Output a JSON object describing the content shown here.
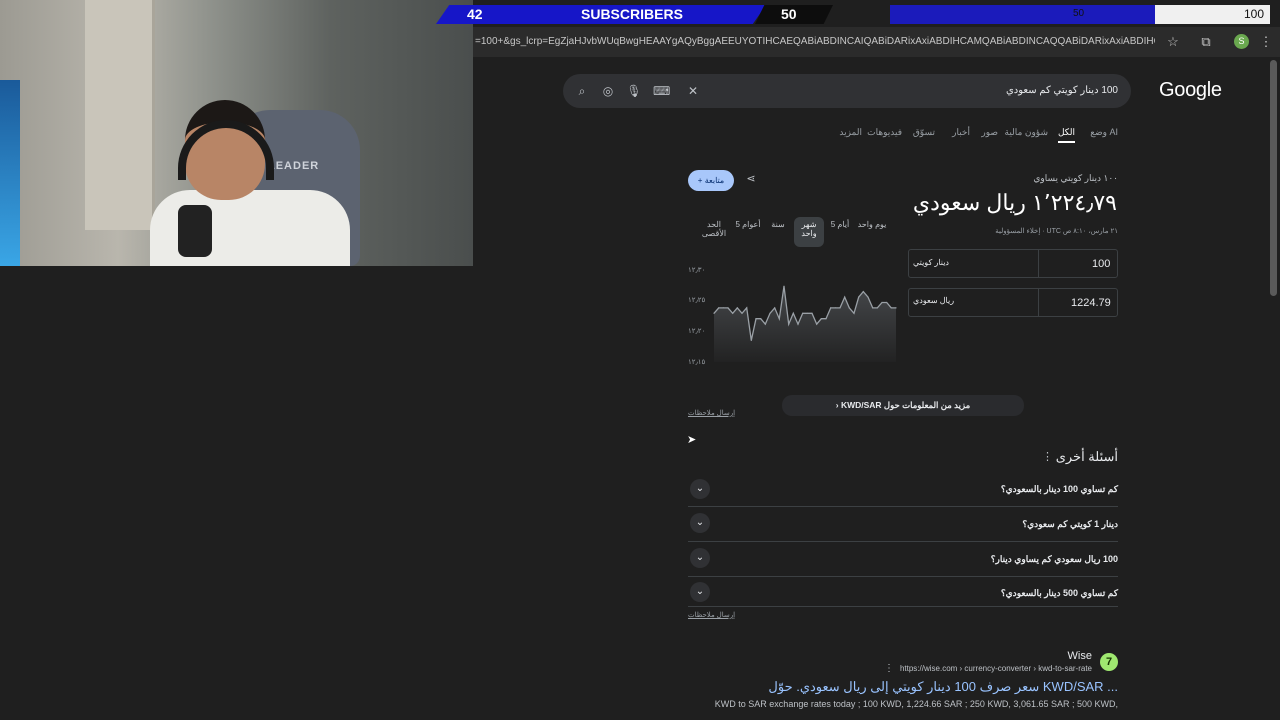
{
  "stream_overlay": {
    "sub_left": "42",
    "sub_label": "SUBSCRIBERS",
    "sub_right": "50",
    "bar2_right_value": "100",
    "bar2_mid_value": "50"
  },
  "browser": {
    "url": "=100+&gs_lcrp=EgZjaHJvbWUqBwgHEAAYgAQyBggAEEUYOTIHCAEQABiABDINCAIQABiDARixAxiABDIHCAMQABiABDINCAQQABiDARixAxiABDIHCAUQABiABDIHCAY...",
    "bookmark_icon": "star-icon",
    "extensions_icon": "puzzle-icon",
    "profile_initial": "S",
    "menu_icon": "kebab-icon"
  },
  "google": {
    "logo": "Google",
    "query": "100 دينار كويتي كم سعودي",
    "tabs": [
      "وضع AI",
      "الكل",
      "شؤون مالية",
      "صور",
      "أخبار",
      "تسوّق",
      "فيديوهات",
      "المزيد"
    ],
    "active_tab": "الكل"
  },
  "converter": {
    "subtitle": "١٠٠ دينار كويتي يساوي",
    "result": "١٬٢٢٤٫٧٩ ريال سعودي",
    "timestamp": "٢١ مارس، ٨:١٠ ص UTC · إخلاء المسؤولية",
    "follow_label": "متابعة",
    "ranges": [
      "يوم واحد",
      "5 أيام",
      "شهر واحد",
      "سنة",
      "5 أعوام",
      "الحد الأقصى"
    ],
    "from_value": "100",
    "from_unit": "دينار كويتي",
    "to_value": "1224.79",
    "to_unit": "ريال سعودي",
    "more_info": "مزيد من المعلومات حول KWD/SAR",
    "feedback": "إرسال ملاحظات"
  },
  "chart_data": {
    "type": "line",
    "title": "",
    "xlabel": "",
    "ylabel": "",
    "yticks": [
      "١٢٫٣٠",
      "١٢٫٢٥",
      "١٢٫٢٠",
      "١٢٫١٥"
    ],
    "ylim": [
      12.15,
      12.32
    ],
    "values": [
      12.24,
      12.25,
      12.25,
      12.25,
      12.24,
      12.25,
      12.24,
      12.25,
      12.19,
      12.23,
      12.23,
      12.22,
      12.24,
      12.25,
      12.23,
      12.29,
      12.22,
      12.24,
      12.22,
      12.24,
      12.24,
      12.24,
      12.22,
      12.23,
      12.23,
      12.25,
      12.25,
      12.25,
      12.27,
      12.25,
      12.24,
      12.27,
      12.28,
      12.27,
      12.25,
      12.25,
      12.26,
      12.26,
      12.25,
      12.25
    ]
  },
  "people_also_ask": {
    "title": "أسئلة أخرى",
    "questions": [
      "كم تساوي 100 دينار بالسعودي؟",
      "دينار 1 كويتي كم سعودي؟",
      "100 ريال سعودي كم يساوي دينار؟",
      "كم تساوي 500 دينار بالسعودي؟"
    ],
    "feedback": "إرسال ملاحظات"
  },
  "result": {
    "site_name": "Wise",
    "breadcrumb": "https://wise.com › currency-converter › kwd-to-sar-rate",
    "title": "سعر صرف 100 دينار كويتي إلى ريال سعودي. حوّل KWD/SAR ...",
    "snippet": "KWD to SAR exchange rates today ; 100 KWD, 1,224.66 SAR ; 250 KWD, 3,061.65 SAR ; 500 KWD,"
  }
}
